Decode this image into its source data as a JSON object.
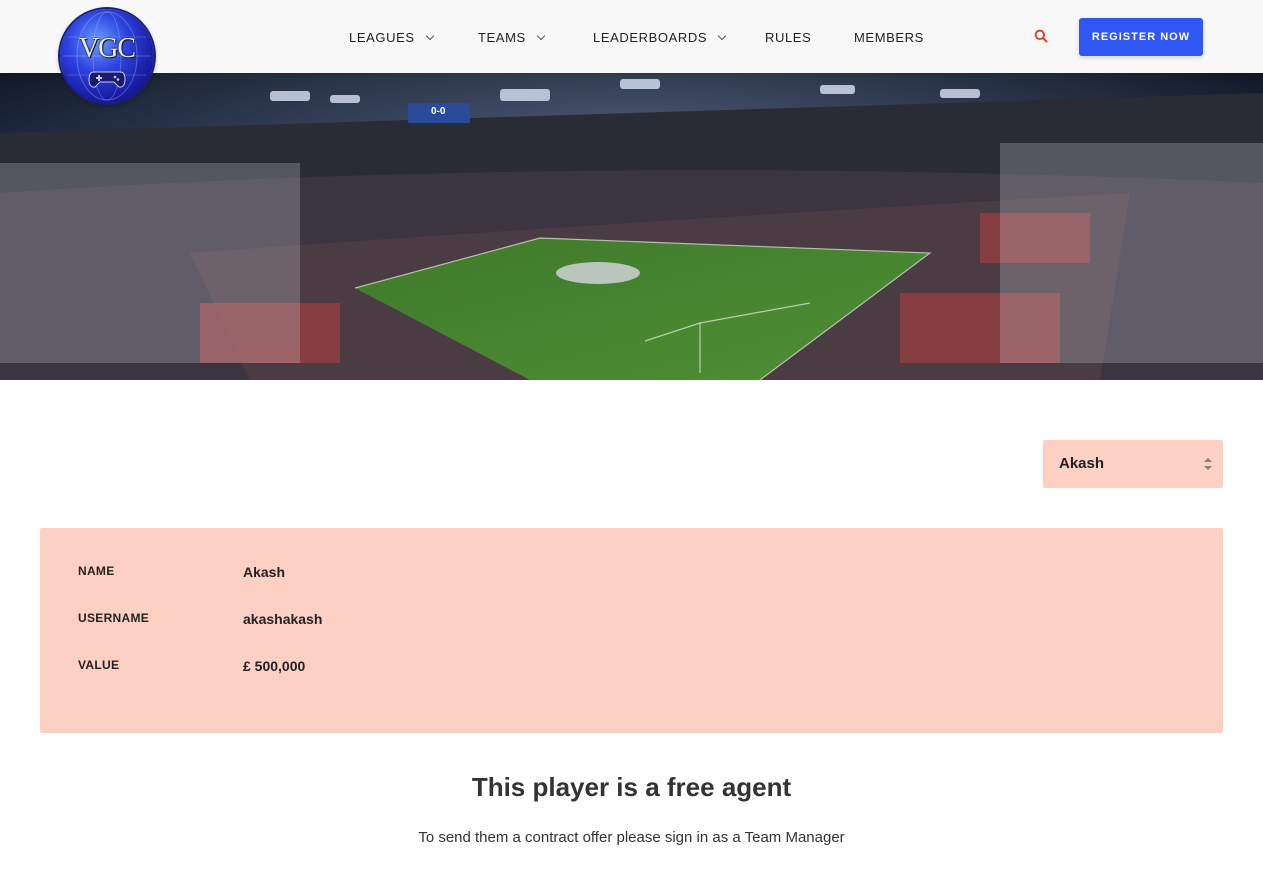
{
  "header": {
    "logo_text": "VGC",
    "nav": [
      {
        "label": "LEAGUES",
        "has_dropdown": true
      },
      {
        "label": "TEAMS",
        "has_dropdown": true
      },
      {
        "label": "LEADERBOARDS",
        "has_dropdown": true
      },
      {
        "label": "RULES",
        "has_dropdown": false
      },
      {
        "label": "MEMBERS",
        "has_dropdown": false
      }
    ],
    "search_icon": "search-icon",
    "register_label": "REGISTER NOW",
    "accent": "#3056f3",
    "search_color": "#e0452b"
  },
  "hero": {
    "scoreboard": "0-0"
  },
  "player_select": {
    "selected": "Akash"
  },
  "player": {
    "rows": [
      {
        "label": "NAME",
        "value": "Akash"
      },
      {
        "label": "USERNAME",
        "value": "akashakash"
      },
      {
        "label": "VALUE",
        "value": "£ 500,000"
      }
    ]
  },
  "status": {
    "title": "This player is a free agent",
    "message": "To send them a contract offer please sign in as a Team Manager"
  },
  "colors": {
    "card_bg": "#fdd0c4",
    "button": "#3056f3"
  }
}
